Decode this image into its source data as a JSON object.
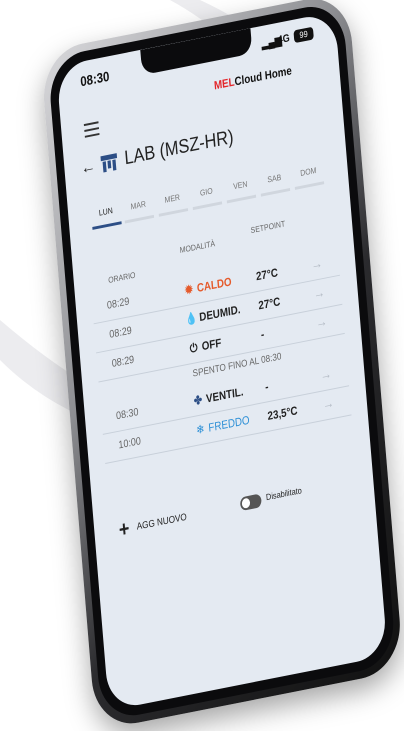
{
  "status": {
    "time": "08:30",
    "network": "4G",
    "battery": "99"
  },
  "header": {
    "brand_prefix": "MEL",
    "brand_rest": "Cloud Home"
  },
  "title": "LAB (MSZ-HR)",
  "days": [
    {
      "label": "LUN",
      "active": true
    },
    {
      "label": "MAR",
      "active": false
    },
    {
      "label": "MER",
      "active": false
    },
    {
      "label": "GIO",
      "active": false
    },
    {
      "label": "VEN",
      "active": false
    },
    {
      "label": "SAB",
      "active": false
    },
    {
      "label": "DOM",
      "active": false
    }
  ],
  "table": {
    "headers": {
      "time": "ORARIO",
      "mode": "MODALITÀ",
      "setpoint": "SETPOINT"
    },
    "rows": [
      {
        "time": "08:29",
        "mode": "CALDO",
        "mode_color": "#e55a2b",
        "icon": "sun-icon",
        "setpoint": "27°C"
      },
      {
        "time": "08:29",
        "mode": "DEUMID.",
        "mode_color": "#222222",
        "icon": "droplet-icon",
        "setpoint": "27°C"
      },
      {
        "time": "08:29",
        "mode": "OFF",
        "mode_color": "#222222",
        "icon": "power-icon",
        "setpoint": "-"
      },
      {
        "time": "08:30",
        "mode": "VENTIL.",
        "mode_color": "#222222",
        "icon": "fan-icon",
        "setpoint": "-"
      },
      {
        "time": "10:00",
        "mode": "FREDDO",
        "mode_color": "#2c8fd6",
        "icon": "snowflake-icon",
        "setpoint": "23,5°C"
      }
    ],
    "off_until": "SPENTO FINO AL 08:30"
  },
  "footer": {
    "add_label": "AGG NUOVO",
    "toggle_label": "Disabilitato"
  },
  "colors": {
    "accent": "#2c4e86",
    "brand_red": "#e3262b",
    "screen_bg": "#e4eaf2"
  }
}
